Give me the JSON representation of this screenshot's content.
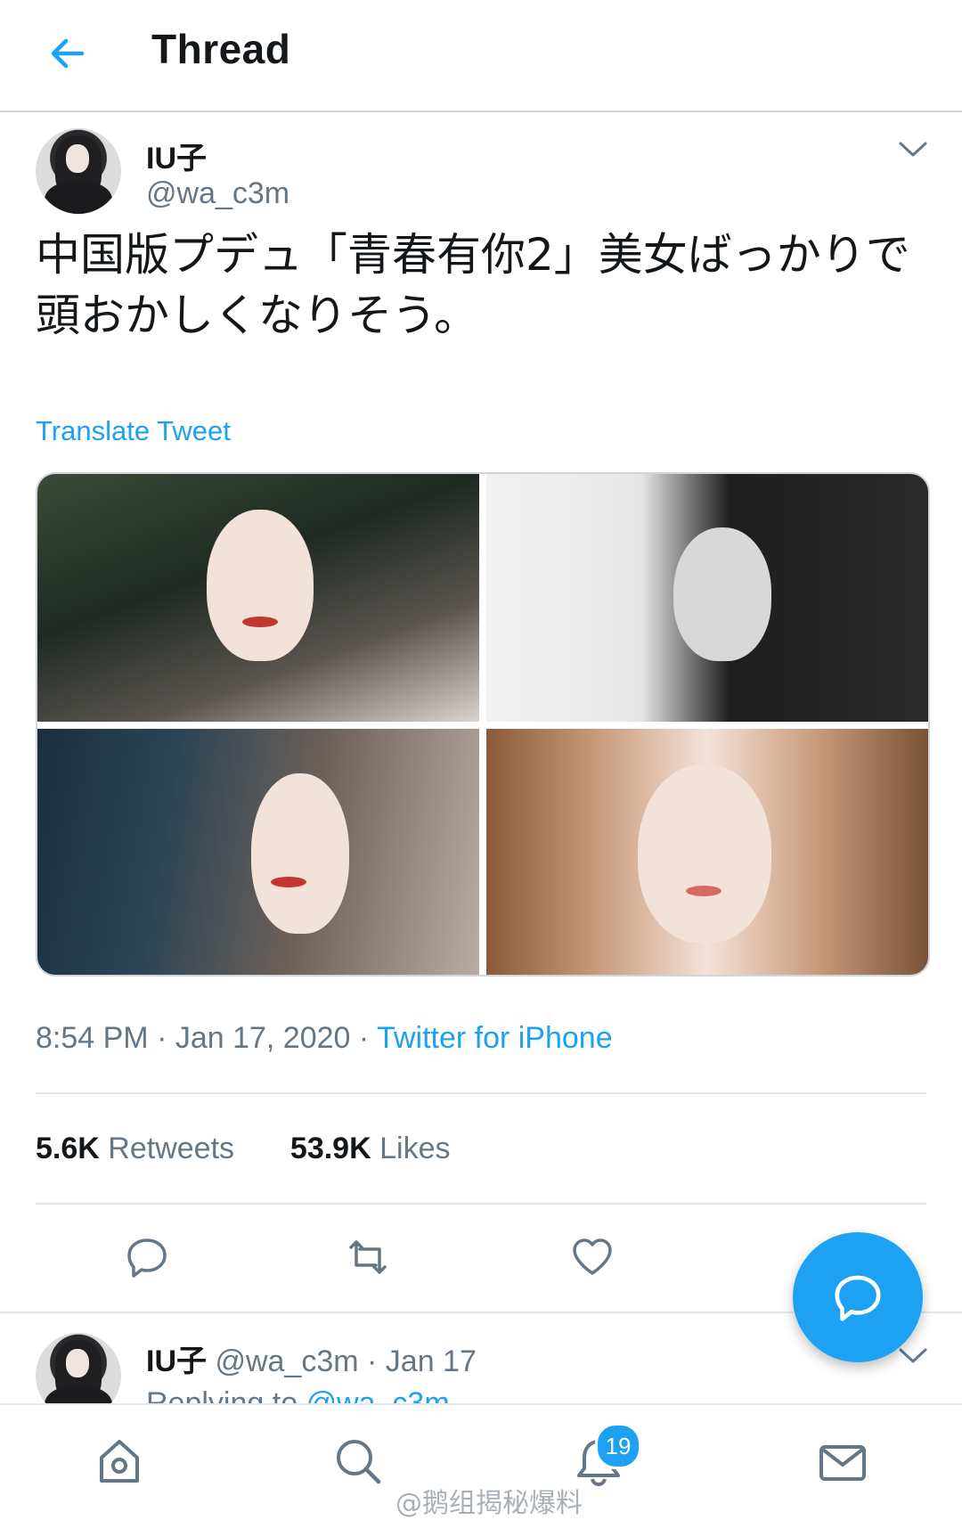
{
  "header": {
    "title": "Thread",
    "back_icon": "back-arrow-icon"
  },
  "tweet": {
    "author_name": "IU子",
    "author_handle": "@wa_c3m",
    "text": "中国版プデュ「青春有你2」美女ばっかりで頭おかしくなりそう。",
    "translate_label": "Translate Tweet",
    "timestamp": "8:54 PM · Jan 17, 2020 · ",
    "source": "Twitter for iPhone",
    "stats": {
      "retweets_count": "5.6K",
      "retweets_label": "Retweets",
      "likes_count": "53.9K",
      "likes_label": "Likes"
    }
  },
  "reply_preview": {
    "author_name": "IU子",
    "author_handle": "@wa_c3m",
    "separator": " · ",
    "date": "Jan 17",
    "replying_label": "Replying to ",
    "replying_handle": "@wa_c3m"
  },
  "bottom_nav": {
    "notifications_badge": "19",
    "icons": [
      "home-icon",
      "search-icon",
      "notifications-icon",
      "messages-icon"
    ]
  },
  "watermark": "@鹅组揭秘爆料",
  "colors": {
    "accent": "#1da1f2",
    "text": "#14171a",
    "muted": "#657786",
    "divider": "#e1e8ed"
  }
}
